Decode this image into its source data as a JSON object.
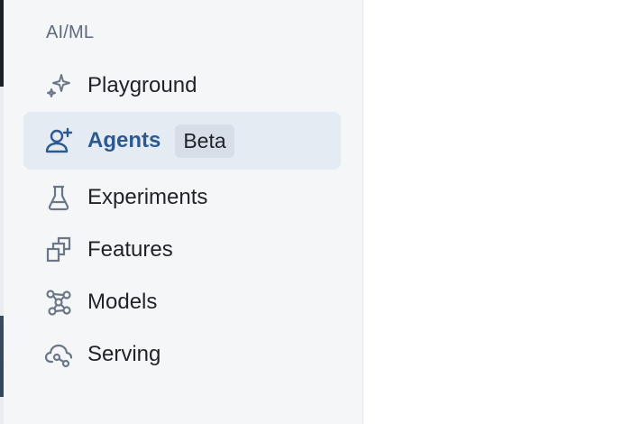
{
  "sidebar": {
    "section_title": "AI/ML",
    "items": [
      {
        "label": "Playground",
        "icon": "sparkle-icon",
        "active": false
      },
      {
        "label": "Agents",
        "icon": "agent-user-plus-icon",
        "active": true,
        "badge": "Beta"
      },
      {
        "label": "Experiments",
        "icon": "flask-icon",
        "active": false
      },
      {
        "label": "Features",
        "icon": "stacked-squares-icon",
        "active": false
      },
      {
        "label": "Models",
        "icon": "model-nodes-icon",
        "active": false
      },
      {
        "label": "Serving",
        "icon": "cloud-serving-icon",
        "active": false
      }
    ]
  },
  "colors": {
    "sidebar_bg": "#f4f6f8",
    "active_bg": "#e4ebf3",
    "active_text": "#2c5a8f",
    "icon_gray": "#6b7786",
    "badge_bg": "#d7dee7"
  }
}
